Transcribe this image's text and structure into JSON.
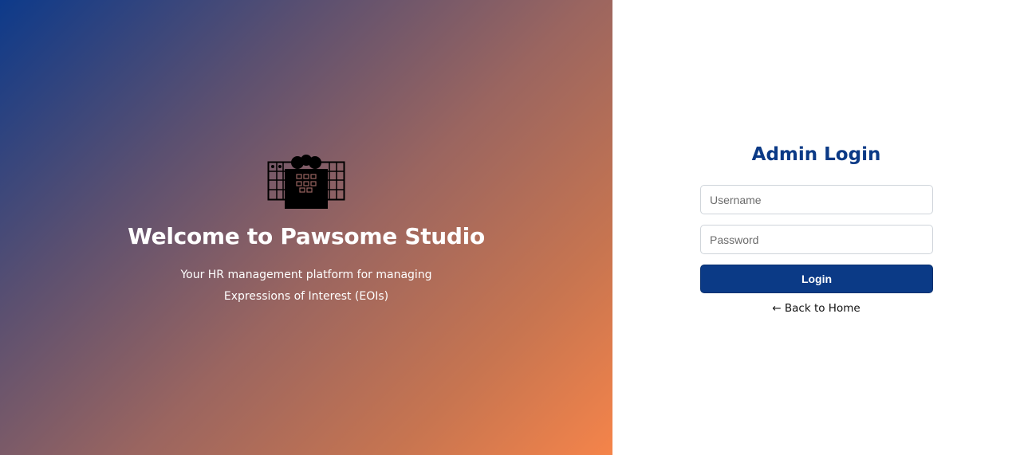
{
  "hero": {
    "title": "Welcome to Pawsome Studio",
    "subtitle_line1": "Your HR management platform for managing",
    "subtitle_line2": "Expressions of Interest (EOIs)",
    "logo_icon": "paw-keyboard-icon"
  },
  "login": {
    "title": "Admin Login",
    "username_placeholder": "Username",
    "password_placeholder": "Password",
    "button_label": "Login",
    "back_link": "← Back to Home"
  },
  "colors": {
    "gradient_start": "#0d3a8a",
    "gradient_end": "#f5844a",
    "accent": "#0b3a86"
  }
}
